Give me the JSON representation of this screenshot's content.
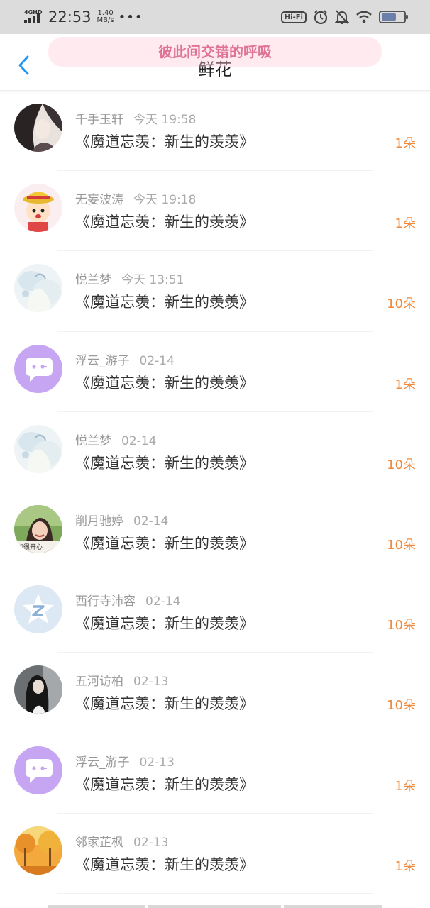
{
  "status_bar": {
    "network": "4GHD",
    "time": "22:53",
    "speed_value": "1.40",
    "speed_unit": "MB/s",
    "more": "•••",
    "hifi": "Hi-Fi"
  },
  "header": {
    "marquee": "彼此间交错的呼吸",
    "title": "鲜花"
  },
  "colors": {
    "accent_blue": "#2196f3",
    "count_orange": "#f08a3c",
    "marquee_pink": "#e07395"
  },
  "rows": [
    {
      "user": "千手玉轩",
      "date": "今天 19:58",
      "book": "《魔道忘羡：新生的羡羡》",
      "count": "1朵",
      "avatar": "dark-haired-girl-illustration"
    },
    {
      "user": "无妄波涛",
      "date": "今天 19:18",
      "book": "《魔道忘羡：新生的羡羡》",
      "count": "1朵",
      "avatar": "cartoon-kid-with-hat"
    },
    {
      "user": "悦兰梦",
      "date": "今天 13:51",
      "book": "《魔道忘羡：新生的羡羡》",
      "count": "10朵",
      "avatar": "pale-watercolor-figure"
    },
    {
      "user": "浮云_游子",
      "date": "02-14",
      "book": "《魔道忘羡：新生的羡羡》",
      "count": "1朵",
      "avatar": "purple-chat-bubble"
    },
    {
      "user": "悦兰梦",
      "date": "02-14",
      "book": "《魔道忘羡：新生的羡羡》",
      "count": "10朵",
      "avatar": "pale-watercolor-figure"
    },
    {
      "user": "削月驰婷",
      "date": "02-14",
      "book": "《魔道忘羡：新生的羡羡》",
      "count": "10朵",
      "avatar": "smiling-girl-photo"
    },
    {
      "user": "西行寺沛容",
      "date": "02-14",
      "book": "《魔道忘羡：新生的羡羡》",
      "count": "10朵",
      "avatar": "blue-z-star-logo"
    },
    {
      "user": "五河访柏",
      "date": "02-13",
      "book": "《魔道忘羡：新生的羡羡》",
      "count": "10朵",
      "avatar": "long-hair-girl-photo"
    },
    {
      "user": "浮云_游子",
      "date": "02-13",
      "book": "《魔道忘羡：新生的羡羡》",
      "count": "1朵",
      "avatar": "purple-chat-bubble"
    },
    {
      "user": "邻家芷枫",
      "date": "02-13",
      "book": "《魔道忘羡：新生的羡羡》",
      "count": "1朵",
      "avatar": "autumn-trees-scene"
    }
  ]
}
